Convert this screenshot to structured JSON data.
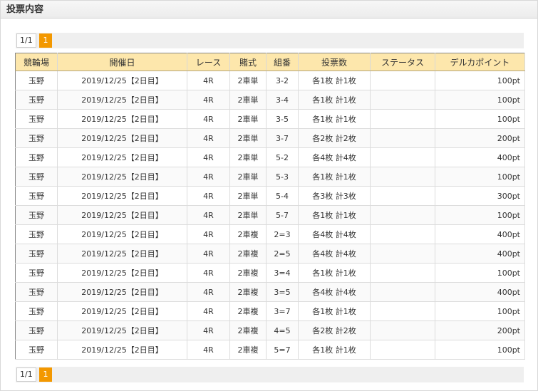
{
  "header": {
    "title": "投票内容"
  },
  "pager_top": {
    "count": "1/1",
    "page": "1"
  },
  "pager_bottom": {
    "count": "1/1",
    "page": "1"
  },
  "table": {
    "columns": [
      "競輪場",
      "開催日",
      "レース",
      "賭式",
      "組番",
      "投票数",
      "ステータス",
      "デルカポイント"
    ],
    "rows": [
      [
        "玉野",
        "2019/12/25【2日目】",
        "4R",
        "2車単",
        "3-2",
        "各1枚 計1枚",
        "",
        "100pt"
      ],
      [
        "玉野",
        "2019/12/25【2日目】",
        "4R",
        "2車単",
        "3-4",
        "各1枚 計1枚",
        "",
        "100pt"
      ],
      [
        "玉野",
        "2019/12/25【2日目】",
        "4R",
        "2車単",
        "3-5",
        "各1枚 計1枚",
        "",
        "100pt"
      ],
      [
        "玉野",
        "2019/12/25【2日目】",
        "4R",
        "2車単",
        "3-7",
        "各2枚 計2枚",
        "",
        "200pt"
      ],
      [
        "玉野",
        "2019/12/25【2日目】",
        "4R",
        "2車単",
        "5-2",
        "各4枚 計4枚",
        "",
        "400pt"
      ],
      [
        "玉野",
        "2019/12/25【2日目】",
        "4R",
        "2車単",
        "5-3",
        "各1枚 計1枚",
        "",
        "100pt"
      ],
      [
        "玉野",
        "2019/12/25【2日目】",
        "4R",
        "2車単",
        "5-4",
        "各3枚 計3枚",
        "",
        "300pt"
      ],
      [
        "玉野",
        "2019/12/25【2日目】",
        "4R",
        "2車単",
        "5-7",
        "各1枚 計1枚",
        "",
        "100pt"
      ],
      [
        "玉野",
        "2019/12/25【2日目】",
        "4R",
        "2車複",
        "2=3",
        "各4枚 計4枚",
        "",
        "400pt"
      ],
      [
        "玉野",
        "2019/12/25【2日目】",
        "4R",
        "2車複",
        "2=5",
        "各4枚 計4枚",
        "",
        "400pt"
      ],
      [
        "玉野",
        "2019/12/25【2日目】",
        "4R",
        "2車複",
        "3=4",
        "各1枚 計1枚",
        "",
        "100pt"
      ],
      [
        "玉野",
        "2019/12/25【2日目】",
        "4R",
        "2車複",
        "3=5",
        "各4枚 計4枚",
        "",
        "400pt"
      ],
      [
        "玉野",
        "2019/12/25【2日目】",
        "4R",
        "2車複",
        "3=7",
        "各1枚 計1枚",
        "",
        "100pt"
      ],
      [
        "玉野",
        "2019/12/25【2日目】",
        "4R",
        "2車複",
        "4=5",
        "各2枚 計2枚",
        "",
        "200pt"
      ],
      [
        "玉野",
        "2019/12/25【2日目】",
        "4R",
        "2車複",
        "5=7",
        "各1枚 計1枚",
        "",
        "100pt"
      ]
    ]
  },
  "colors": {
    "accent": "#f39800",
    "header_bg": "#fde7ac"
  }
}
